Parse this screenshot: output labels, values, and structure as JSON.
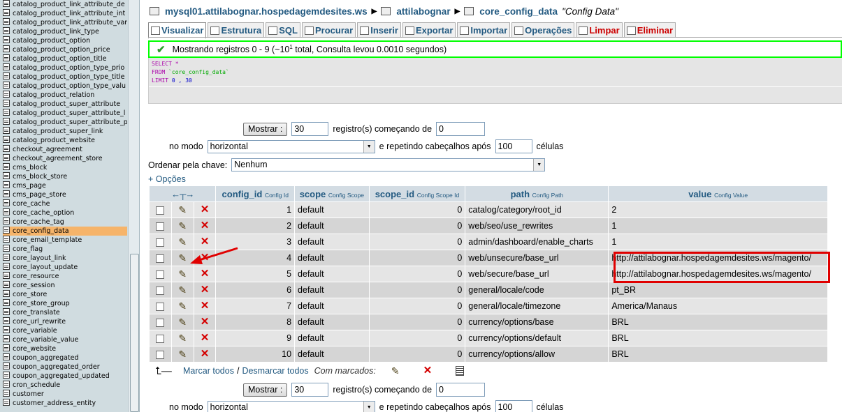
{
  "sidebar": {
    "tables": [
      "catalog_product_link_attribute_de",
      "catalog_product_link_attribute_int",
      "catalog_product_link_attribute_var",
      "catalog_product_link_type",
      "catalog_product_option",
      "catalog_product_option_price",
      "catalog_product_option_title",
      "catalog_product_option_type_prio",
      "catalog_product_option_type_title",
      "catalog_product_option_type_valu",
      "catalog_product_relation",
      "catalog_product_super_attribute",
      "catalog_product_super_attribute_l",
      "catalog_product_super_attribute_p",
      "catalog_product_super_link",
      "catalog_product_website",
      "checkout_agreement",
      "checkout_agreement_store",
      "cms_block",
      "cms_block_store",
      "cms_page",
      "cms_page_store",
      "core_cache",
      "core_cache_option",
      "core_cache_tag",
      "core_config_data",
      "core_email_template",
      "core_flag",
      "core_layout_link",
      "core_layout_update",
      "core_resource",
      "core_session",
      "core_store",
      "core_store_group",
      "core_translate",
      "core_url_rewrite",
      "core_variable",
      "core_variable_value",
      "core_website",
      "coupon_aggregated",
      "coupon_aggregated_order",
      "coupon_aggregated_updated",
      "cron_schedule",
      "customer",
      "customer_address_entity"
    ],
    "active_index": 25
  },
  "breadcrumb": {
    "server": "mysql01.attilabognar.hospedagemdesites.ws",
    "database": "attilabognar",
    "table": "core_config_data",
    "comment": "\"Config Data\""
  },
  "tabs": [
    {
      "label": "Visualizar",
      "icon": "browse-icon"
    },
    {
      "label": "Estrutura",
      "icon": "structure-icon"
    },
    {
      "label": "SQL",
      "icon": "sql-icon"
    },
    {
      "label": "Procurar",
      "icon": "search-icon"
    },
    {
      "label": "Inserir",
      "icon": "insert-icon"
    },
    {
      "label": "Exportar",
      "icon": "export-icon"
    },
    {
      "label": "Importar",
      "icon": "import-icon"
    },
    {
      "label": "Operações",
      "icon": "operations-icon"
    },
    {
      "label": "Limpar",
      "icon": "empty-icon"
    },
    {
      "label": "Eliminar",
      "icon": "drop-icon"
    }
  ],
  "notice": {
    "text_before": "Mostrando registros 0 - 9 (~10",
    "sup": "1",
    "text_after": " total, Consulta levou 0.0010 segundos)"
  },
  "sql": {
    "line1": "SELECT *",
    "line2_kw": "FROM",
    "line2_tbl": "`core_config_data`",
    "line3_kw": "LIMIT",
    "line3_num": "0 , 30"
  },
  "nav": {
    "show_label": "Mostrar :",
    "rows_value": "30",
    "records_starting": "registro(s) começando de",
    "start_value": "0",
    "mode_label": "no modo",
    "mode_value": "horizontal",
    "repeat_label": "e repetindo cabeçalhos após",
    "repeat_value": "100",
    "cells_label": "células",
    "sort_label": "Ordenar pela chave:",
    "sort_value": "Nenhum"
  },
  "options_link": "+ Opções",
  "columns": [
    {
      "name": "config_id",
      "comment": "Config Id"
    },
    {
      "name": "scope",
      "comment": "Config Scope"
    },
    {
      "name": "scope_id",
      "comment": "Config Scope Id"
    },
    {
      "name": "path",
      "comment": "Config Path"
    },
    {
      "name": "value",
      "comment": "Config Value"
    }
  ],
  "rows": [
    {
      "config_id": "1",
      "scope": "default",
      "scope_id": "0",
      "path": "catalog/category/root_id",
      "value": "2"
    },
    {
      "config_id": "2",
      "scope": "default",
      "scope_id": "0",
      "path": "web/seo/use_rewrites",
      "value": "1"
    },
    {
      "config_id": "3",
      "scope": "default",
      "scope_id": "0",
      "path": "admin/dashboard/enable_charts",
      "value": "1"
    },
    {
      "config_id": "4",
      "scope": "default",
      "scope_id": "0",
      "path": "web/unsecure/base_url",
      "value": "http://attilabognar.hospedagemdesites.ws/magento/"
    },
    {
      "config_id": "5",
      "scope": "default",
      "scope_id": "0",
      "path": "web/secure/base_url",
      "value": "http://attilabognar.hospedagemdesites.ws/magento/"
    },
    {
      "config_id": "6",
      "scope": "default",
      "scope_id": "0",
      "path": "general/locale/code",
      "value": "pt_BR"
    },
    {
      "config_id": "7",
      "scope": "default",
      "scope_id": "0",
      "path": "general/locale/timezone",
      "value": "America/Manaus"
    },
    {
      "config_id": "8",
      "scope": "default",
      "scope_id": "0",
      "path": "currency/options/base",
      "value": "BRL"
    },
    {
      "config_id": "9",
      "scope": "default",
      "scope_id": "0",
      "path": "currency/options/default",
      "value": "BRL"
    },
    {
      "config_id": "10",
      "scope": "default",
      "scope_id": "0",
      "path": "currency/options/allow",
      "value": "BRL"
    }
  ],
  "mark": {
    "check_all": "Marcar todos",
    "slash": "/",
    "uncheck_all": "Desmarcar todos",
    "with_selected": "Com marcados:"
  },
  "colors": {
    "link": "#235a81",
    "highlight": "#e00000",
    "notice_border": "#00ff00",
    "active_sidebar": "#f6b46a"
  }
}
